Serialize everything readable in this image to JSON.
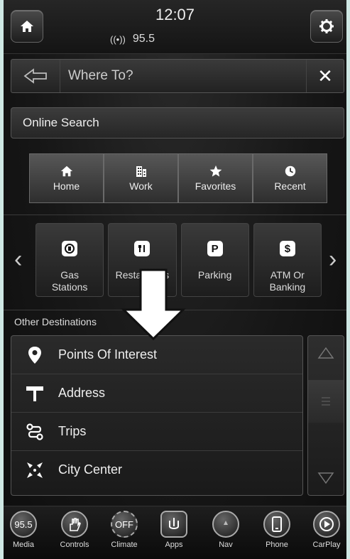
{
  "status": {
    "clock": "12:07",
    "radio_station": "95.5"
  },
  "search": {
    "title": "Where To?",
    "close": "✕"
  },
  "online_search": {
    "label": "Online Search"
  },
  "quick_tabs": [
    {
      "label": "Home",
      "icon": "home-icon"
    },
    {
      "label": "Work",
      "icon": "building-icon"
    },
    {
      "label": "Favorites",
      "icon": "star-icon"
    },
    {
      "label": "Recent",
      "icon": "clock-icon"
    }
  ],
  "categories": [
    {
      "line1": "Gas",
      "line2": "Stations",
      "icon": "gas-pump-icon",
      "glyph": "⛽"
    },
    {
      "line1": "Restaurants",
      "line2": "",
      "icon": "restaurant-icon",
      "glyph": "🍴"
    },
    {
      "line1": "Parking",
      "line2": "",
      "icon": "parking-icon",
      "glyph": "P"
    },
    {
      "line1": "ATM Or",
      "line2": "Banking",
      "icon": "dollar-icon",
      "glyph": "$"
    }
  ],
  "other": {
    "heading": "Other Destinations",
    "items": [
      {
        "label": "Points Of Interest",
        "icon": "map-pin-icon"
      },
      {
        "label": "Address",
        "icon": "signpost-icon"
      },
      {
        "label": "Trips",
        "icon": "route-icon"
      },
      {
        "label": "City Center",
        "icon": "city-center-icon"
      }
    ]
  },
  "bottom_nav": [
    {
      "label": "Media",
      "badge": "95.5"
    },
    {
      "label": "Controls",
      "badge": ""
    },
    {
      "label": "Climate",
      "badge": "OFF"
    },
    {
      "label": "Apps",
      "badge": ""
    },
    {
      "label": "Nav",
      "badge": ""
    },
    {
      "label": "Phone",
      "badge": ""
    },
    {
      "label": "CarPlay",
      "badge": ""
    }
  ]
}
